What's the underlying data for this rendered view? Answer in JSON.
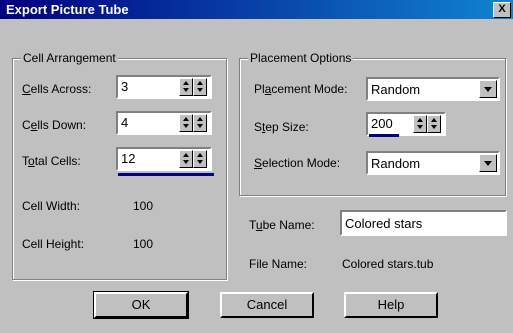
{
  "window": {
    "title": "Export Picture Tube",
    "close_glyph": "X"
  },
  "cell_arrangement": {
    "legend": "Cell Arrangement",
    "cells_across": {
      "label_u": "C",
      "label_rest": "ells Across:",
      "value": "3"
    },
    "cells_down": {
      "label_pre": "C",
      "label_u": "e",
      "label_rest": "lls Down:",
      "value": "4"
    },
    "total_cells": {
      "label_pre": "T",
      "label_u": "o",
      "label_rest": "tal Cells:",
      "value": "12"
    },
    "cell_width": {
      "label": "Cell Width:",
      "value": "100"
    },
    "cell_height": {
      "label": "Cell Height:",
      "value": "100"
    }
  },
  "placement_options": {
    "legend": "Placement Options",
    "placement_mode": {
      "label_pre": "Pl",
      "label_u": "a",
      "label_rest": "cement Mode:",
      "value": "Random"
    },
    "step_size": {
      "label_pre": "S",
      "label_u": "t",
      "label_rest": "ep Size:",
      "value": "200"
    },
    "selection_mode": {
      "label_u": "S",
      "label_rest": "election Mode:",
      "value": "Random"
    }
  },
  "tube_name": {
    "label_pre": "T",
    "label_u": "u",
    "label_rest": "be Name:",
    "value": "Colored stars"
  },
  "file_name": {
    "label": "File Name:",
    "value": "Colored stars.tub"
  },
  "buttons": {
    "ok": "OK",
    "cancel": "Cancel",
    "help": "Help"
  }
}
